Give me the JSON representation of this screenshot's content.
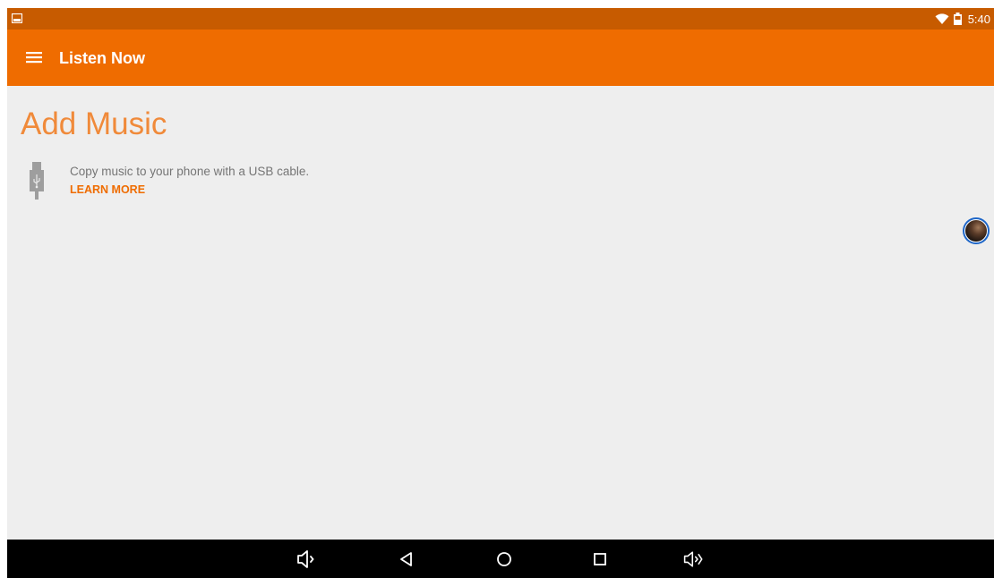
{
  "status_bar": {
    "time": "5:40",
    "icons": [
      "gallery-notification-icon",
      "wifi-icon",
      "battery-icon"
    ]
  },
  "app_bar": {
    "menu_icon": "menu-icon",
    "title": "Listen Now"
  },
  "main": {
    "heading": "Add Music",
    "usb_hint": {
      "icon": "usb-icon",
      "text": "Copy music to your phone with a USB cable.",
      "link_label": "LEARN MORE"
    }
  },
  "floating": {
    "icon": "avatar-bubble"
  },
  "nav_bar": {
    "buttons": [
      "volume-down-icon",
      "back-icon",
      "home-icon",
      "recents-icon",
      "volume-up-icon"
    ]
  },
  "colors": {
    "status_bar": "#c75b00",
    "app_bar": "#ef6c00",
    "accent": "#ef6c00",
    "heading": "#f08a3a",
    "background": "#eeeeee",
    "nav_bar": "#000000"
  }
}
